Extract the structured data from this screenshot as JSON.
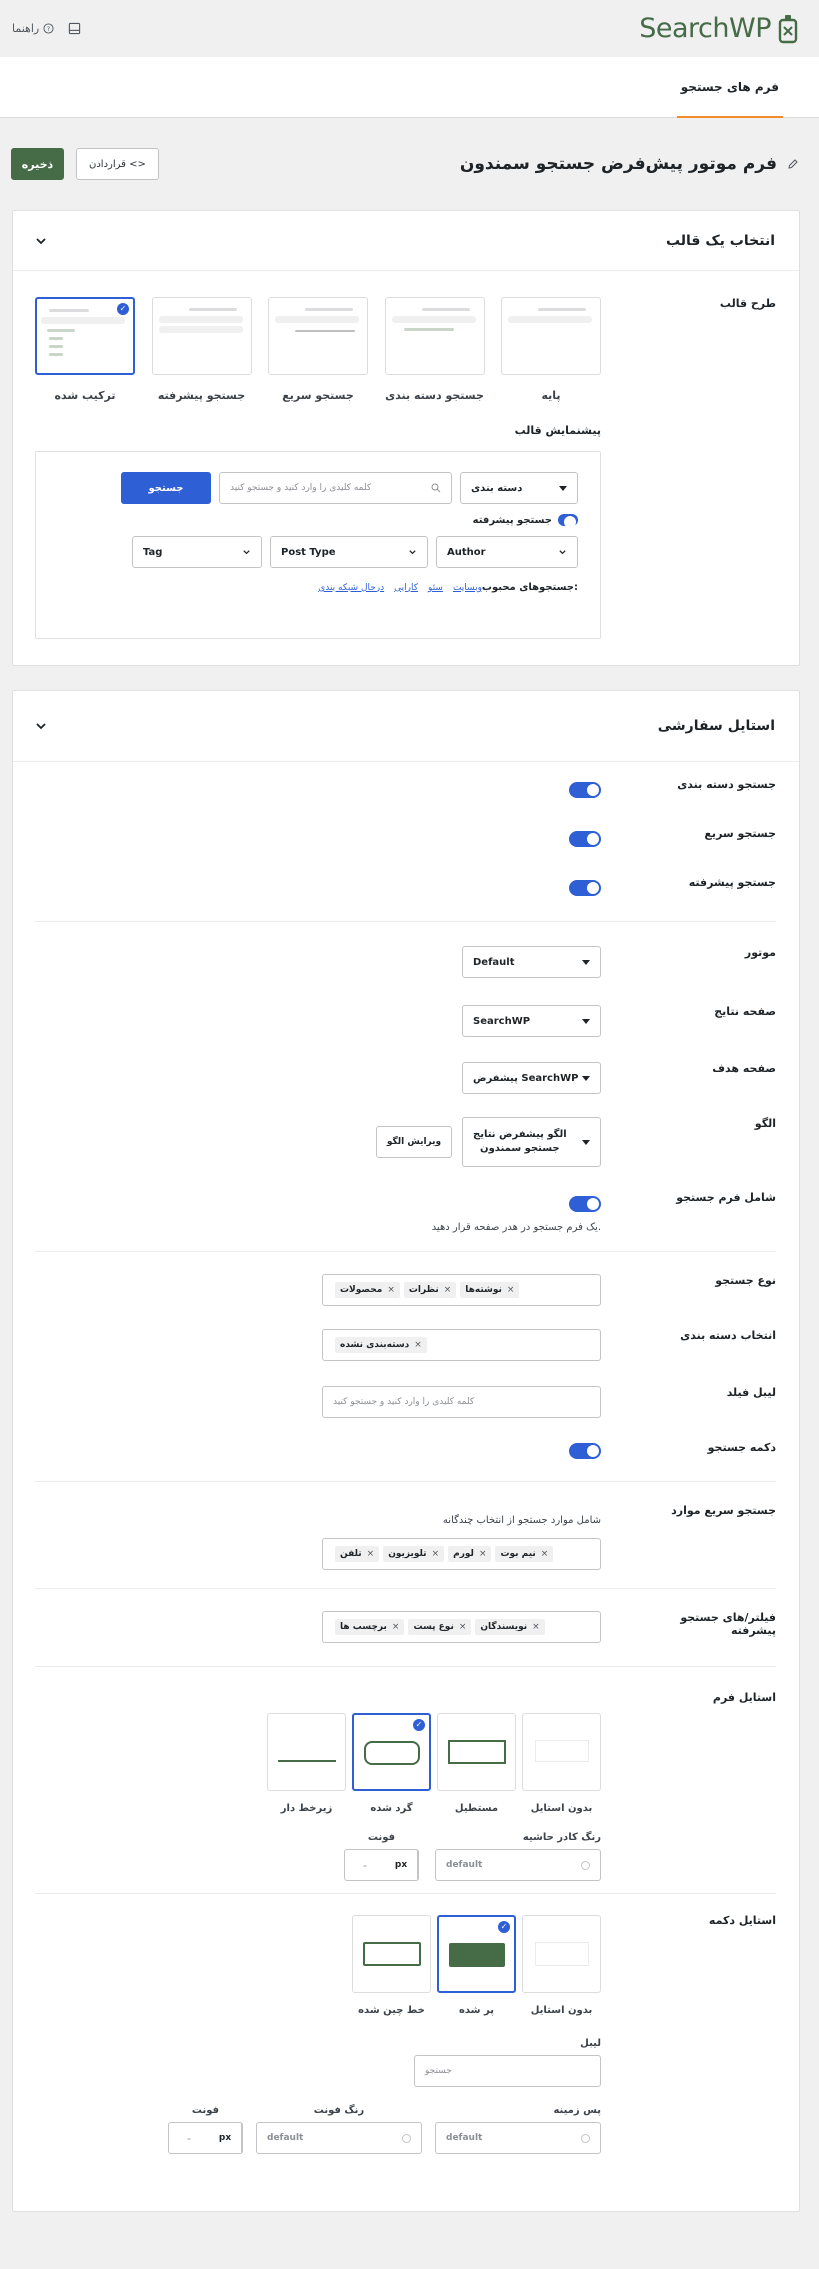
{
  "topbar": {
    "help_label": "راهنما",
    "brand": "SearchWP"
  },
  "tab": {
    "label": "فرم های جستجو"
  },
  "header": {
    "title": "فرم موتور پیش‌فرض جستجو سمندون",
    "embed_label": "قراردادن",
    "save_label": "ذخیره"
  },
  "template_card": {
    "title": "انتخاب یک قالب",
    "layout_label": "طرح قالب",
    "templates": [
      {
        "label": "پایه"
      },
      {
        "label": "جستجو دسته بندی"
      },
      {
        "label": "جستجو سریع"
      },
      {
        "label": "جستجو پیشرفته"
      },
      {
        "label": "ترکیب شده"
      }
    ],
    "preview_label": "پیشنمایش قالب",
    "preview": {
      "category": "دسته بندی",
      "search_placeholder": "کلمه کلیدی را وارد کنید و جستجو کنید",
      "search_button": "جستجو",
      "advanced_label": "جستجو پیشرفته",
      "filters": [
        "Author",
        "Post Type",
        "Tag"
      ],
      "popular_label": "جستجوهای محبوب:",
      "popular_links": [
        "وبسایت",
        "سئو",
        "کارایی",
        "درحال شبکه بندی"
      ]
    }
  },
  "style_card": {
    "title": "استایل سفارشی",
    "category_search": "جستجو دسته بندی",
    "quick_search": "جستجو سریع",
    "advanced_search": "جستجو پیشرفته",
    "engine_label": "موتور",
    "engine_value": "Default",
    "results_label": "صفحه نتایج",
    "results_value": "SearchWP",
    "target_label": "صفحه هدف",
    "target_value": "پیشفرض SearchWP",
    "pattern_label": "الگو",
    "pattern_value_line1": "الگو پیشفرض نتایج",
    "pattern_value_line2": "جستجو سمندون",
    "edit_pattern": "ویرایش الگو",
    "include_form_label": "شامل فرم جستجو",
    "include_form_help": "یک فرم جستجو در هدر صفحه قرار دهید.",
    "search_type_label": "نوع جستجو",
    "search_types": [
      "محصولات",
      "نظرات",
      "نوشته‌ها"
    ],
    "category_select_label": "انتخاب دسته بندی",
    "category_chips": [
      "دسته‌بندی نشده"
    ],
    "field_label_label": "لیبل فیلد",
    "field_label_placeholder": "کلمه کلیدی را وارد کنید و جستجو کنید",
    "search_button_label": "دکمه جستجو",
    "quick_items_label": "جستجو سریع موارد",
    "quick_items_help": "شامل موارد جستجو از انتخاب چندگانه",
    "quick_items": [
      "تلفن",
      "تلویزیون",
      "لورم",
      "نیم بوت"
    ],
    "adv_filters_label": "فیلتر/های جستجو پیشرفته",
    "adv_filters": [
      "برچسب ها",
      "نوع پست",
      "نویسندگان"
    ],
    "form_style_label": "استایل فرم",
    "form_styles": [
      "بدون استایل",
      "مستطیل",
      "گرد شده",
      "زیرخط دار"
    ],
    "border_color_label": "رنگ کادر حاشیه",
    "border_color_value": "default",
    "font_label": "فونت",
    "font_value": "-",
    "unit": "px",
    "button_style_label": "استایل دکمه",
    "button_styles": [
      "بدون استایل",
      "پر شده",
      "خط چین شده"
    ],
    "label_label": "لیبل",
    "label_value": "جستجو",
    "bg_label": "پس زمینه",
    "bg_value": "default",
    "font_color_label": "رنگ فونت",
    "font_color_value": "default",
    "font2_label": "فونت",
    "font2_value": "-"
  }
}
